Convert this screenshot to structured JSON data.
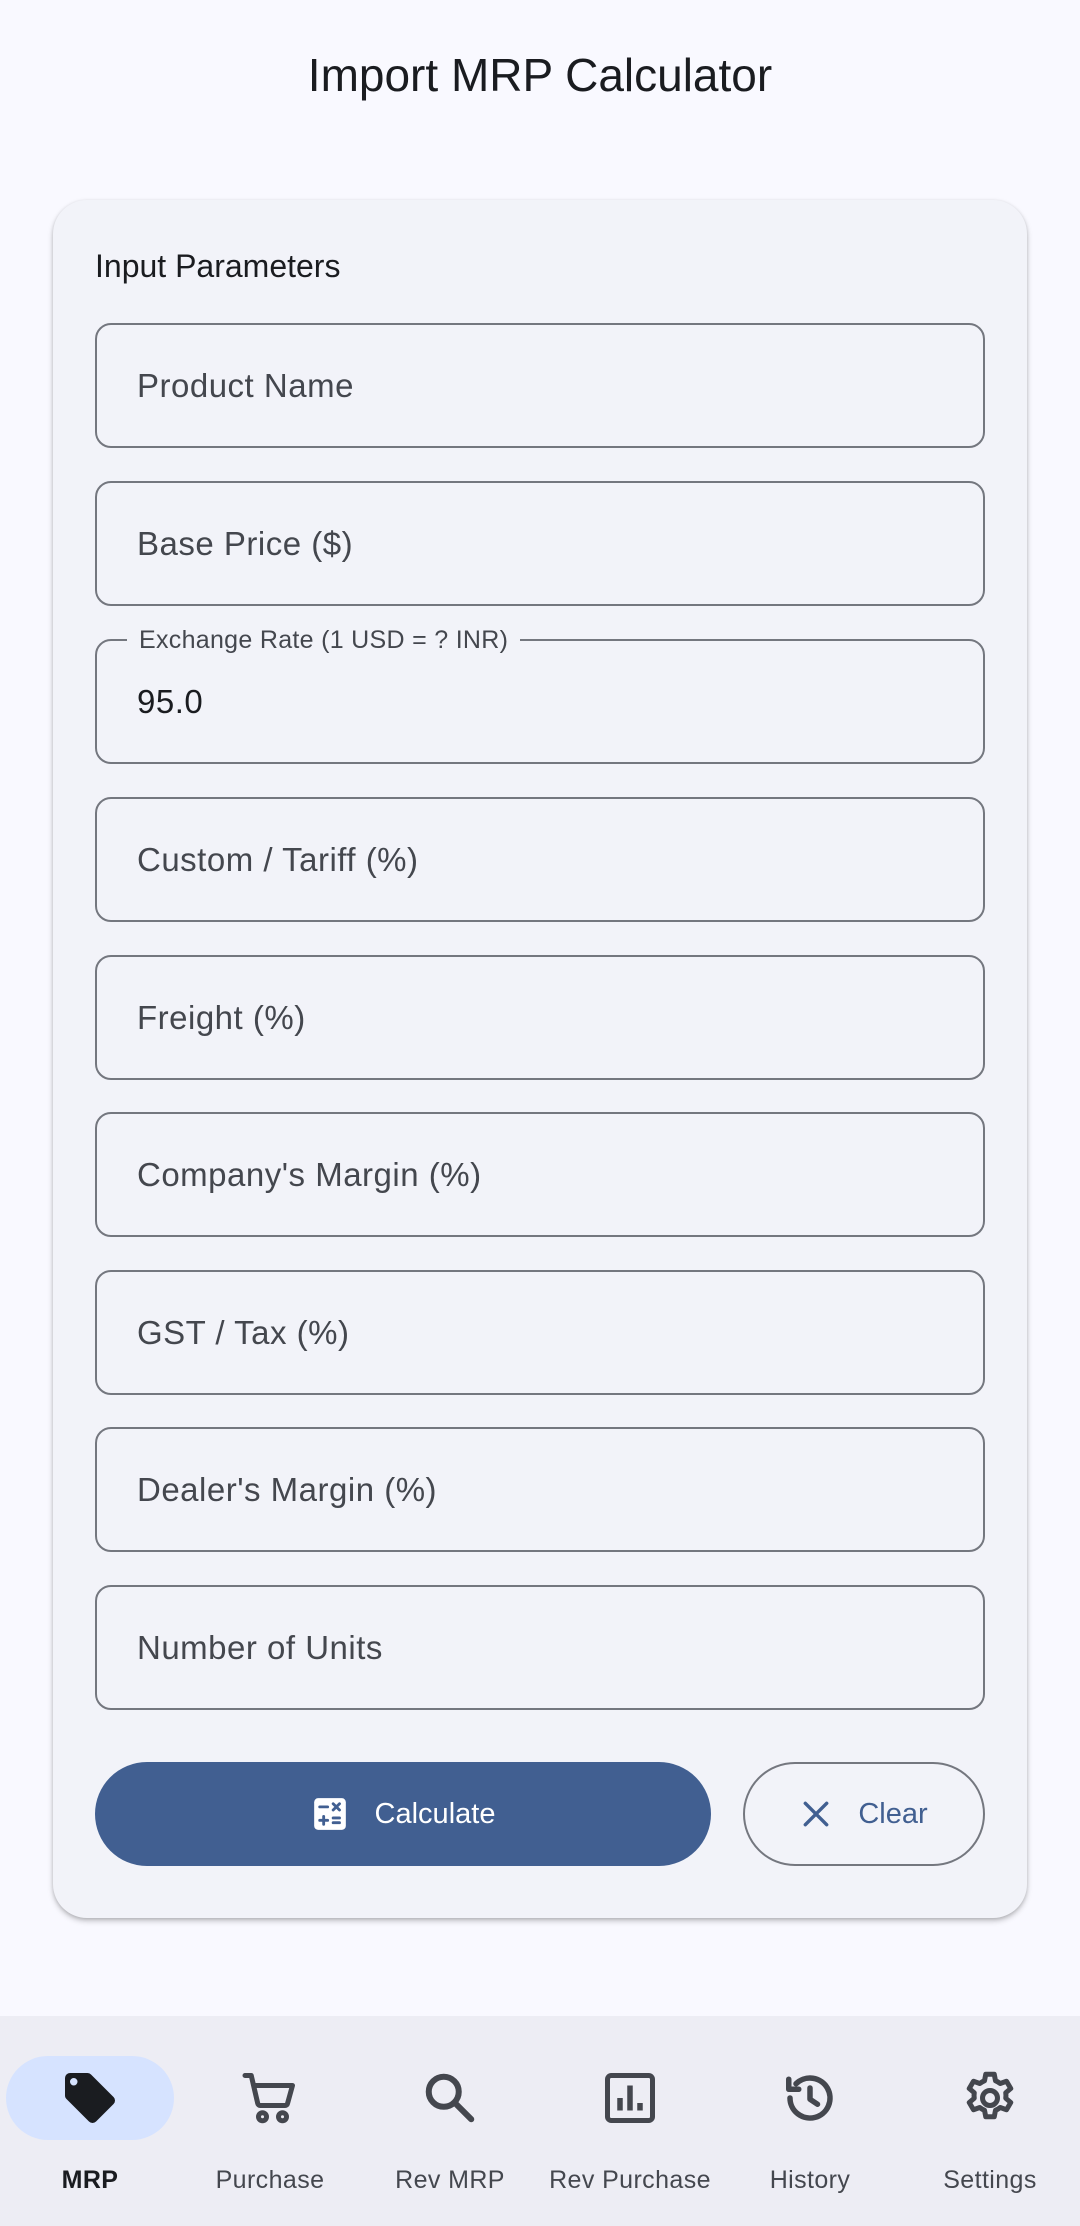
{
  "app": {
    "title": "Import MRP Calculator"
  },
  "form": {
    "section_title": "Input Parameters",
    "fields": [
      {
        "placeholder": "Product Name",
        "value": ""
      },
      {
        "placeholder": "Base Price ($)",
        "value": ""
      },
      {
        "label": "Exchange Rate (1 USD = ? INR)",
        "value": "95.0"
      },
      {
        "placeholder": "Custom / Tariff (%)",
        "value": ""
      },
      {
        "placeholder": "Freight (%)",
        "value": ""
      },
      {
        "placeholder": "Company's Margin (%)",
        "value": ""
      },
      {
        "placeholder": "GST / Tax (%)",
        "value": ""
      },
      {
        "placeholder": "Dealer's Margin (%)",
        "value": ""
      },
      {
        "placeholder": "Number of Units",
        "value": ""
      }
    ],
    "calculate_label": "Calculate",
    "clear_label": "Clear"
  },
  "nav": {
    "items": [
      {
        "label": "MRP",
        "icon": "tag-icon",
        "active": true
      },
      {
        "label": "Purchase",
        "icon": "cart-icon",
        "active": false
      },
      {
        "label": "Rev MRP",
        "icon": "search-icon",
        "active": false
      },
      {
        "label": "Rev Purchase",
        "icon": "bar-chart-icon",
        "active": false
      },
      {
        "label": "History",
        "icon": "history-icon",
        "active": false
      },
      {
        "label": "Settings",
        "icon": "gear-icon",
        "active": false
      }
    ]
  },
  "colors": {
    "primary": "#415f91",
    "nav_active_indicator": "#d6e3ff",
    "background": "#f9f9ff",
    "card": "#f2f3f9",
    "outline": "#74777f"
  }
}
